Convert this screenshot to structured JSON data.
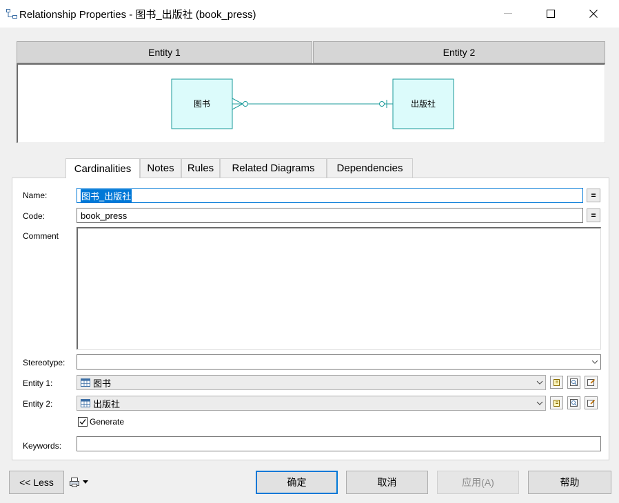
{
  "window": {
    "title": "Relationship Properties - 图书_出版社 (book_press)",
    "minimize_label": "—",
    "maximize_label": "☐",
    "close_label": "✕"
  },
  "entities_header": {
    "entity1": "Entity 1",
    "entity2": "Entity 2"
  },
  "diagram": {
    "entity1_name": "图书",
    "entity2_name": "出版社",
    "box_fill": "#dcfbfb",
    "line_color": "#1a9a9a"
  },
  "tabs": [
    {
      "label": "Cardinalities",
      "active": true
    },
    {
      "label": "Notes",
      "active": false
    },
    {
      "label": "Rules",
      "active": false
    },
    {
      "label": "Related Diagrams",
      "active": false
    },
    {
      "label": "Dependencies",
      "active": false
    }
  ],
  "form": {
    "name_label": "Name:",
    "name_value": "图书_出版社",
    "code_label": "Code:",
    "code_value": "book_press",
    "eq_label": "=",
    "comment_label": "Comment",
    "comment_value": "",
    "stereotype_label": "Stereotype:",
    "stereotype_value": "",
    "entity1_label": "Entity 1:",
    "entity1_value": "图书",
    "entity2_label": "Entity 2:",
    "entity2_value": "出版社",
    "generate_label": "Generate",
    "generate_checked": true,
    "keywords_label": "Keywords:",
    "keywords_value": ""
  },
  "buttons": {
    "less": "<< Less",
    "ok": "确定",
    "cancel": "取消",
    "apply": "应用(A)",
    "help": "帮助"
  },
  "colors": {
    "accent": "#0078d7",
    "entity_box_border": "#1a9a9a"
  }
}
